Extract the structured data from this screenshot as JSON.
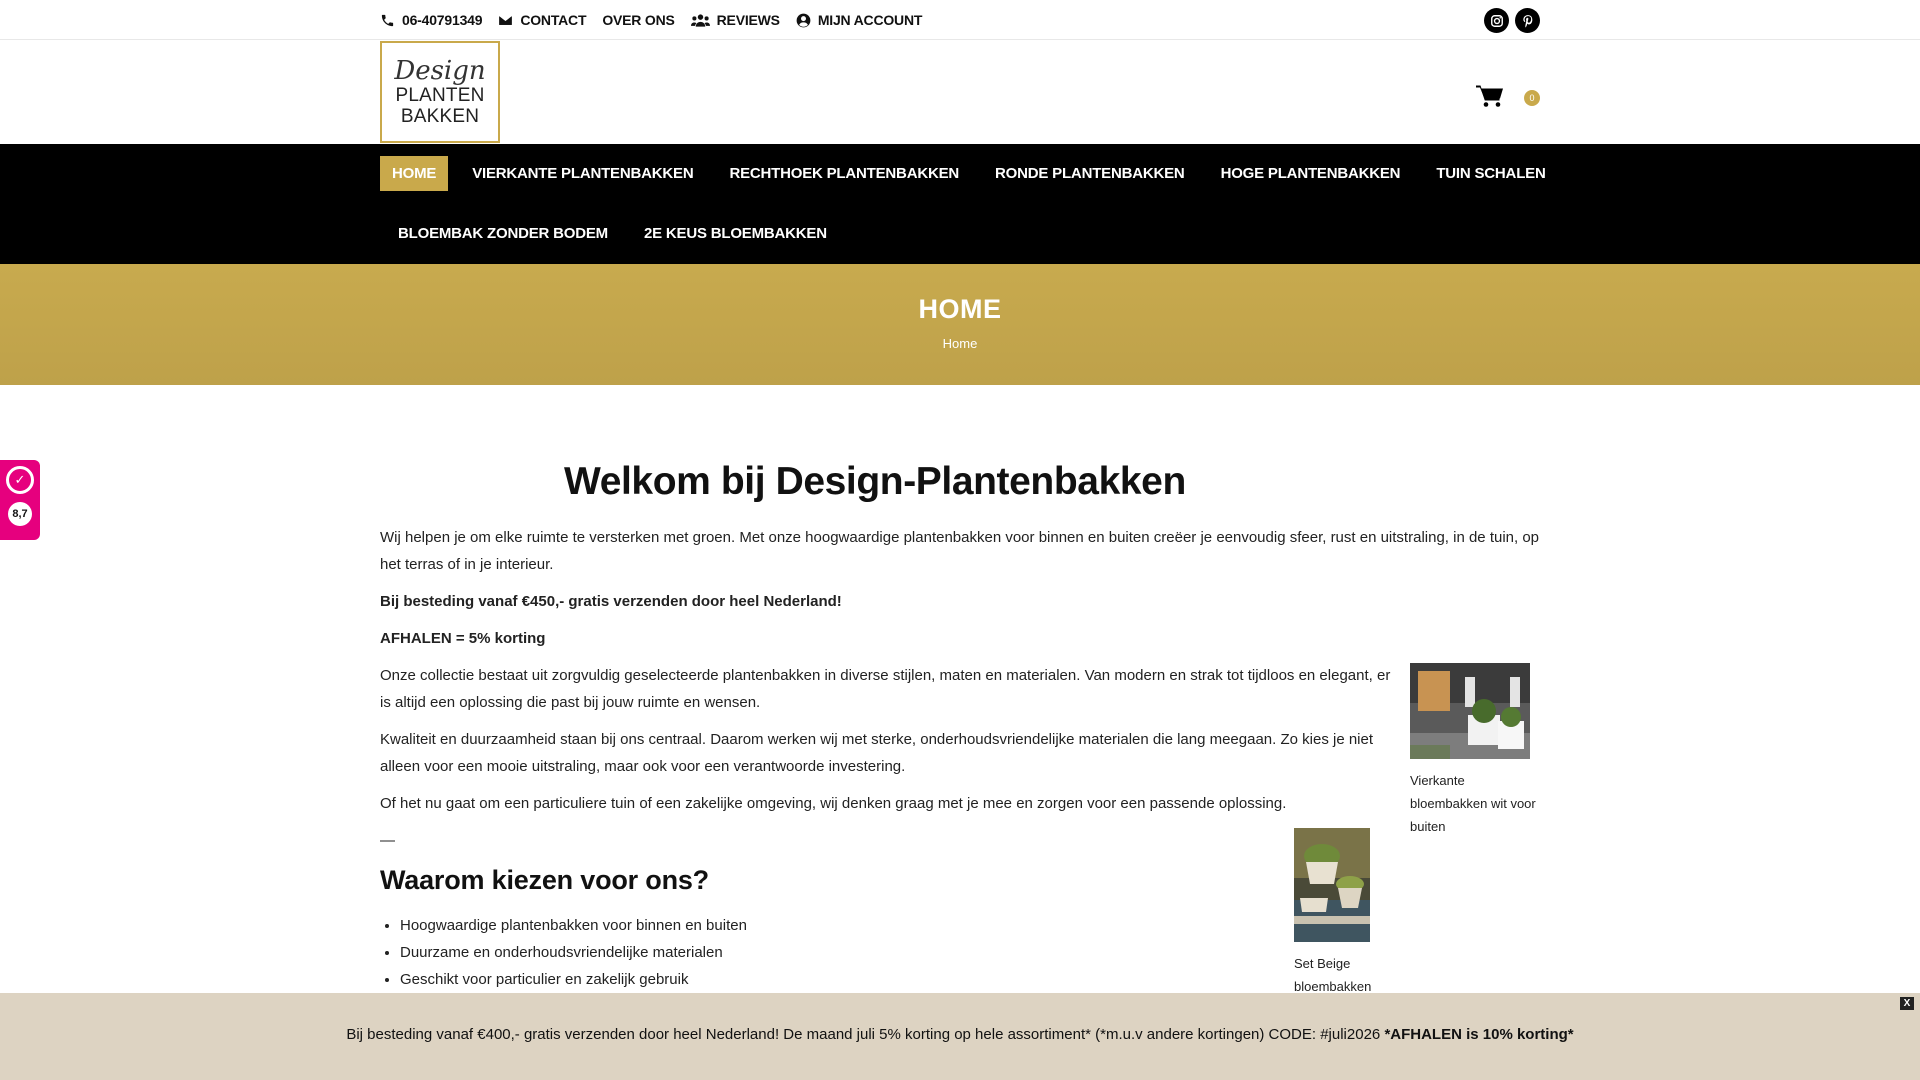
{
  "topbar": {
    "phone": "06-40791349",
    "contact": "CONTACT",
    "about": "OVER ONS",
    "reviews": "REVIEWS",
    "account": "MIJN ACCOUNT"
  },
  "logo": {
    "line1": "Design",
    "line2": "PLANTEN",
    "line3": "BAKKEN"
  },
  "cart": {
    "count": "0"
  },
  "nav": {
    "row1": [
      "HOME",
      "VIERKANTE PLANTENBAKKEN",
      "RECHTHOEK PLANTENBAKKEN",
      "RONDE PLANTENBAKKEN",
      "HOGE PLANTENBAKKEN",
      "TUIN SCHALEN"
    ],
    "row2": [
      "BLOEMBAK ZONDER BODEM",
      "2E KEUS BLOEMBAKKEN"
    ]
  },
  "hero": {
    "title": "HOME",
    "breadcrumb": "Home"
  },
  "rating": {
    "score": "8,7"
  },
  "content": {
    "heading": "Welkom bij Design-Plantenbakken",
    "intro": "Wij helpen je om elke ruimte te versterken met groen. Met onze hoogwaardige plantenbakken voor binnen en buiten creëer je eenvoudig sfeer, rust en uitstraling, in de tuin, op het terras of in je interieur.",
    "free_shipping": "Bij besteding vanaf €450,- gratis verzenden door heel Nederland!",
    "pickup": "AFHALEN = 5% korting",
    "collection": "Onze collectie bestaat uit zorgvuldig geselecteerde plantenbakken in diverse stijlen, maten en materialen. Van modern en strak tot tijdloos en elegant, er is altijd een oplossing die past bij jouw ruimte en wensen.",
    "quality": "Kwaliteit en duurzaamheid staan bij ons centraal. Daarom werken wij met sterke, onderhoudsvriendelijke materialen die lang meegaan. Zo kies je niet alleen voor een mooie uitstraling, maar ook voor een verantwoorde investering.",
    "business": "Of het nu gaat om een particuliere tuin of een zakelijke omgeving, wij denken graag met je mee en zorgen voor een passende oplossing.",
    "divider": "—",
    "why_heading": "Waarom kiezen voor ons?",
    "why_items": [
      "Hoogwaardige plantenbakken voor binnen en buiten",
      "Duurzame en onderhoudsvriendelijke materialen",
      "Geschikt voor particulier en zakelijk gebruik"
    ],
    "figure1_caption": "Vierkante bloembakken wit voor buiten",
    "figure2_caption": "Set Beige bloembakken"
  },
  "cookiebar": {
    "text": "Bij besteding vanaf €400,- gratis verzenden door heel Nederland! De maand juli 5% korting op hele assortiment* (*m.u.v andere kortingen) CODE: #juli2026 ",
    "bold": "*AFHALEN is 10% korting*",
    "close": "X"
  },
  "colors": {
    "accent": "#c9a94b",
    "nav_bg": "#000000",
    "badge": "#e6007e",
    "cookie_bg": "#ddd3c2"
  },
  "icons": [
    "phone-icon",
    "envelope-icon",
    "users-icon",
    "user-circle-icon",
    "instagram-icon",
    "pinterest-icon",
    "cart-icon",
    "kiyoh-icon"
  ]
}
